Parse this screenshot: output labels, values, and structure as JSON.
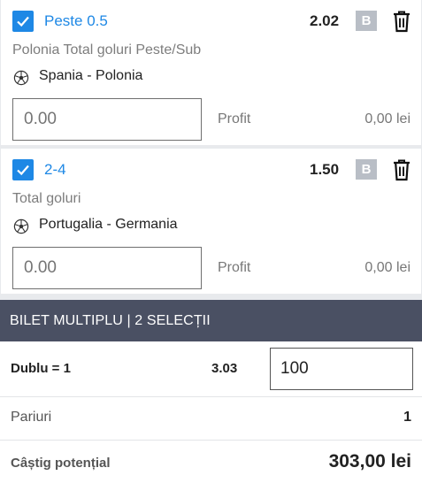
{
  "selections": [
    {
      "name": "Peste 0.5",
      "odd": "2.02",
      "badge": "B",
      "market": "Polonia Total goluri Peste/Sub",
      "match": "Spania - Polonia",
      "stake_placeholder": "0.00",
      "profit_label": "Profit",
      "profit_value": "0,00 lei",
      "checked": true
    },
    {
      "name": "2-4",
      "odd": "1.50",
      "badge": "B",
      "market": "Total goluri",
      "match": "Portugalia - Germania",
      "stake_placeholder": "0.00",
      "profit_label": "Profit",
      "profit_value": "0,00 lei",
      "checked": true
    }
  ],
  "multi": {
    "header": "BILET MULTIPLU | 2 SELECȚII",
    "combo_label": "Dublu = 1",
    "combo_odd": "3.03",
    "combo_stake": "100",
    "bets_label": "Pariuri",
    "bets_value": "1",
    "win_label": "Câștig potențial",
    "win_value": "303,00 lei"
  },
  "colors": {
    "accent": "#1e88e5",
    "header_bg": "#4a5063",
    "badge_bg": "#b9bec6",
    "page_bg": "#e8eaed"
  },
  "icons": [
    "check-icon",
    "trash-icon",
    "soccer-ball-icon"
  ]
}
